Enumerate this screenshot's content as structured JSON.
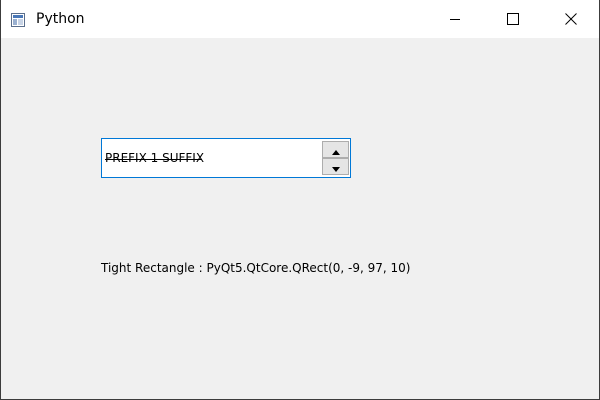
{
  "window": {
    "title": "Python",
    "app_icon": "python-app-icon",
    "controls": {
      "minimize_icon": "minimize-icon",
      "maximize_icon": "maximize-icon",
      "close_icon": "close-icon"
    }
  },
  "spinbox": {
    "value_text": "PREFIX 1 SUFFIX",
    "up_icon": "arrow-up-icon",
    "down_icon": "arrow-down-icon",
    "focus_border_color": "#0078d7"
  },
  "label": {
    "text": "Tight Rectangle : PyQt5.QtCore.QRect(0, -9, 97, 10)"
  }
}
